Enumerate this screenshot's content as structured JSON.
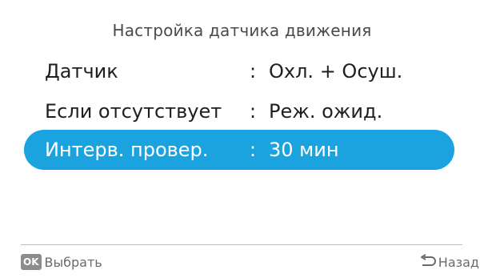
{
  "screen": {
    "title": "Настройка датчика движения"
  },
  "menu": {
    "items": [
      {
        "label": "Датчик",
        "separator": ":",
        "value": "Охл. + Осуш.",
        "selected": false
      },
      {
        "label": "Если отсутствует",
        "separator": ":",
        "value": "Реж. ожид.",
        "selected": false
      },
      {
        "label": "Интерв. провер.",
        "separator": ":",
        "value": "30 мин",
        "selected": true
      }
    ]
  },
  "footer": {
    "ok_badge": "OK",
    "ok_label": "Выбрать",
    "back_label": "Назад",
    "ok_icon": "ok-button-icon",
    "back_icon": "return-arrow-icon"
  },
  "colors": {
    "highlight": "#1aa3df",
    "text": "#1f1f1f",
    "muted": "#6b6b6b"
  }
}
